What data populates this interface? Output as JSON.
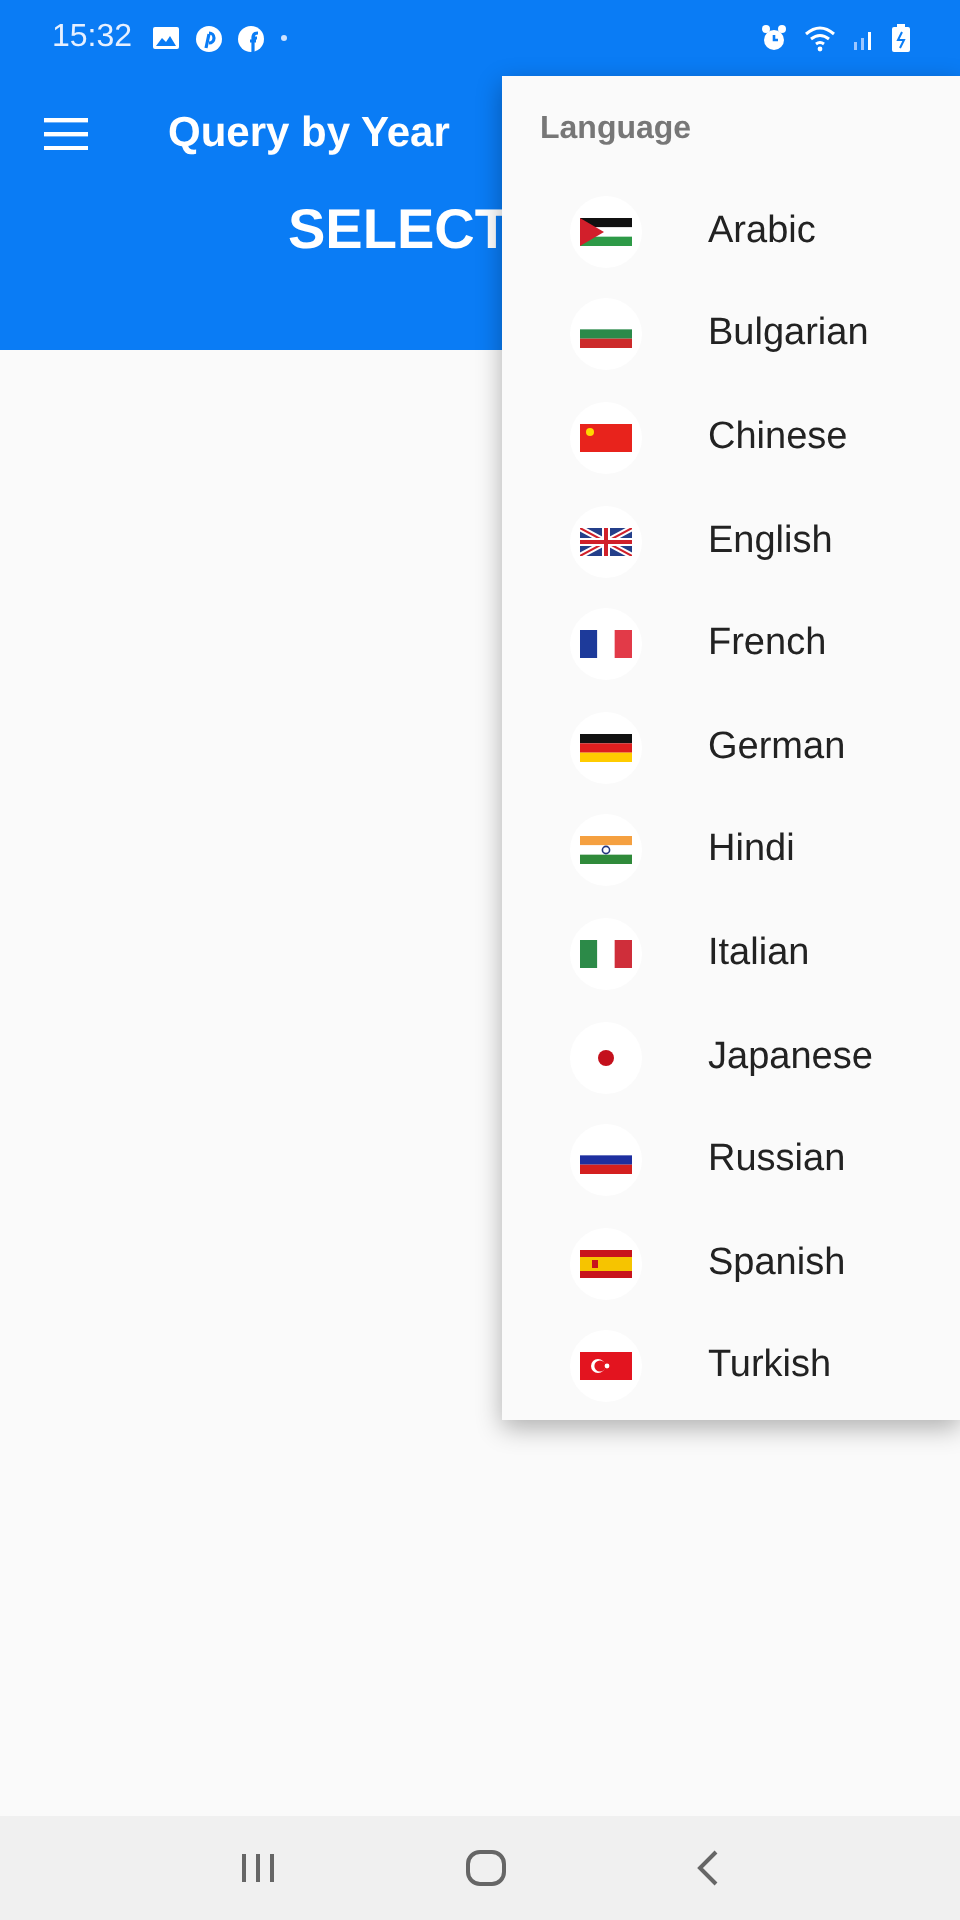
{
  "status_bar": {
    "time": "15:32"
  },
  "app_bar": {
    "title": "Query by Year"
  },
  "banner": {
    "text": "SELECT"
  },
  "menu": {
    "header": "Language",
    "items": [
      {
        "label": "Arabic",
        "kind": "jordan"
      },
      {
        "label": "Bulgarian",
        "kind": "bulgaria"
      },
      {
        "label": "Chinese",
        "kind": "china"
      },
      {
        "label": "English",
        "kind": "uk"
      },
      {
        "label": "French",
        "kind": "france"
      },
      {
        "label": "German",
        "kind": "germany"
      },
      {
        "label": "Hindi",
        "kind": "india"
      },
      {
        "label": "Italian",
        "kind": "italy"
      },
      {
        "label": "Japanese",
        "kind": "japan"
      },
      {
        "label": "Russian",
        "kind": "russia"
      },
      {
        "label": "Spanish",
        "kind": "spain"
      },
      {
        "label": "Turkish",
        "kind": "turkey"
      }
    ]
  }
}
